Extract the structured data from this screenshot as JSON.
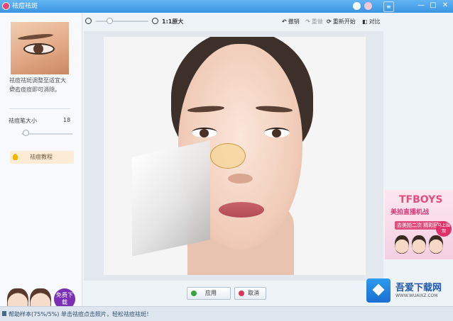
{
  "window": {
    "title": "祛痘祛斑"
  },
  "toolbar": {
    "original_size_label": "1:1原大",
    "undo_label": "撤销",
    "redo_label": "重做",
    "reset_label": "重新开始",
    "compare_label": "对比"
  },
  "sidebar": {
    "tip_line1": "祛痘祛斑调整至适宜大小，",
    "tip_line2": "点击痘痘即可消除。",
    "brush_size_label": "祛痘笔大小",
    "brush_size_value": "18",
    "brush_level": 0.08,
    "help_label": "祛痘教程",
    "promo_button": "免费下载"
  },
  "zoom": {
    "level": 0.25
  },
  "ad": {
    "title": "TFBOYS",
    "subtitle": "美拍直播机战",
    "tag": "去美拍二次 精彩回放",
    "badge": "马上围观"
  },
  "actions": {
    "apply_label": "应用",
    "cancel_label": "取消"
  },
  "watermark": {
    "name": "吾爱下载网",
    "url": "WWW.WUAIXZ.COM"
  },
  "status": {
    "text": "帮助样本(75%/5%) 单击祛痘点击照片，轻松祛痘祛斑！"
  },
  "colors": {
    "titlebar": "#3a95e3",
    "accent": "#e14f7e",
    "promo": "#7b2fb5"
  }
}
